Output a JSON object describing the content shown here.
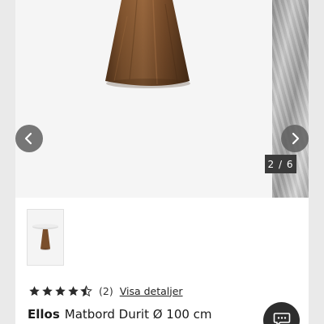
{
  "gallery": {
    "counter": "2 / 6",
    "current_index": 2,
    "total_images": 6
  },
  "product": {
    "brand": "Ellos",
    "title": "Matbord Durit Ø 100 cm",
    "rating_stars": 4.5,
    "review_count": "(2)",
    "details_link": "Visa detaljer"
  },
  "icons": {
    "prev": "chevron-left-icon",
    "next": "chevron-right-icon",
    "chat": "chat-bubble-icon",
    "star": "star-icon"
  },
  "colors": {
    "wood": "#7a4f2c",
    "nav_button": "#5f5f5f",
    "counter_bg": "#3b3b3b",
    "star": "#2a2a2a",
    "chat_bg": "#2d2d2d"
  }
}
